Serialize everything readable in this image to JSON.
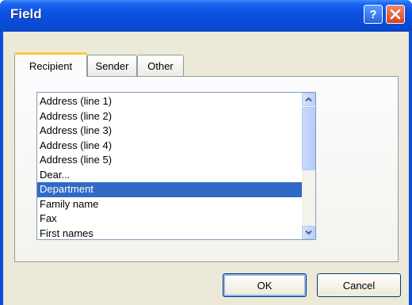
{
  "window": {
    "title": "Field",
    "help_label": "?",
    "close_label": "✕"
  },
  "tabs": [
    {
      "label": "Recipient",
      "active": true
    },
    {
      "label": "Sender",
      "active": false
    },
    {
      "label": "Other",
      "active": false
    }
  ],
  "fields_list": {
    "items": [
      "Address (line 1)",
      "Address (line 2)",
      "Address (line 3)",
      "Address (line 4)",
      "Address (line 5)",
      "Dear...",
      "Department",
      "Family name",
      "Fax",
      "First names"
    ],
    "selected": "Department"
  },
  "buttons": {
    "ok": "OK",
    "cancel": "Cancel"
  },
  "icons": {
    "help": "help-icon",
    "close": "close-icon",
    "scroll_up": "chevron-up-icon",
    "scroll_down": "chevron-down-icon"
  },
  "colors": {
    "titlebar": "#0a4bd6",
    "selection": "#316ac5",
    "dialog_face": "#ece9d8",
    "active_tab_accent": "#ffc83c"
  }
}
